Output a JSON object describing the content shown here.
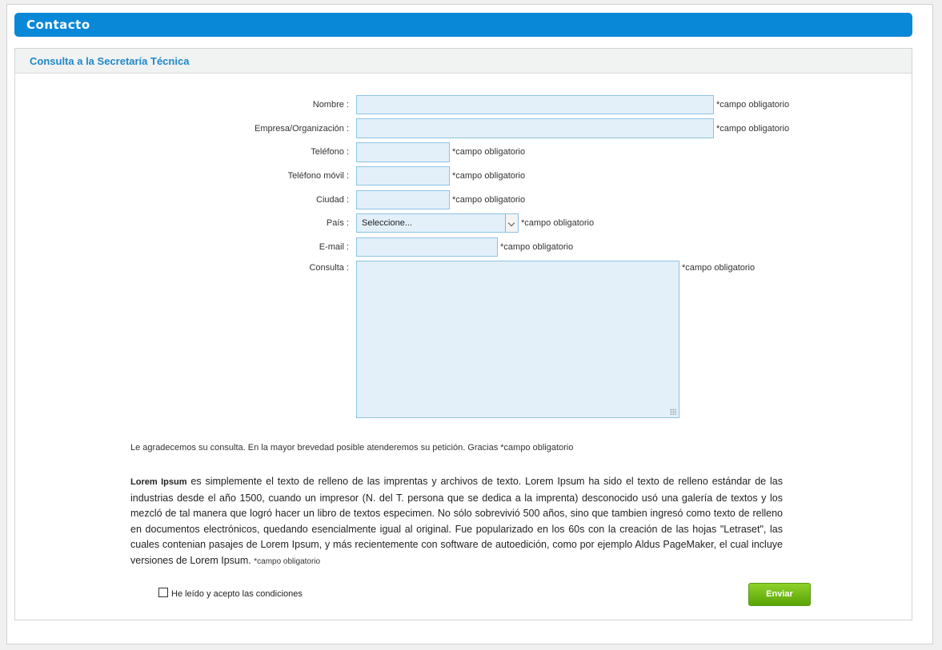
{
  "header": {
    "title": "Contacto"
  },
  "panel": {
    "title": "Consulta a la Secretaría Técnica"
  },
  "required_text": "*campo obligatorio",
  "form": {
    "nombre": {
      "label": "Nombre :",
      "value": ""
    },
    "empresa": {
      "label": "Empresa/Organización :",
      "value": ""
    },
    "telefono": {
      "label": "Teléfono :",
      "value": ""
    },
    "movil": {
      "label": "Teléfono móvil :",
      "value": ""
    },
    "ciudad": {
      "label": "Ciudad :",
      "value": ""
    },
    "pais": {
      "label": "País :",
      "selected": "Seleccione..."
    },
    "email": {
      "label": "E-mail :",
      "value": ""
    },
    "consulta": {
      "label": "Consulta :",
      "value": ""
    }
  },
  "thanks_note": "Le agradecemos su consulta. En la mayor brevedad posible atenderemos su petición. Gracias *campo obligatorio",
  "lorem": {
    "bold": "Lorem Ipsum",
    "text": " es simplemente el texto de relleno de las imprentas y archivos de texto. Lorem Ipsum ha sido el texto de relleno estándar de las industrias desde el año 1500, cuando un impresor (N. del T. persona que se dedica a la imprenta) desconocido usó una galería de textos y los mezcló de tal manera que logró hacer un libro de textos especimen. No sólo sobrevivió 500 años, sino que tambien ingresó como texto de relleno en documentos electrónicos, quedando esencialmente igual al original. Fue popularizado en los 60s con la creación de las hojas \"Letraset\", las cuales contenian pasajes de Lorem Ipsum, y más recientemente con software de autoedición, como por ejemplo Aldus PageMaker, el cual incluye versiones de Lorem Ipsum. ",
    "required": "*campo obligatorio"
  },
  "terms": {
    "label": "He leído y acepto las condiciones",
    "checked": false
  },
  "submit": {
    "label": "Enviar"
  }
}
